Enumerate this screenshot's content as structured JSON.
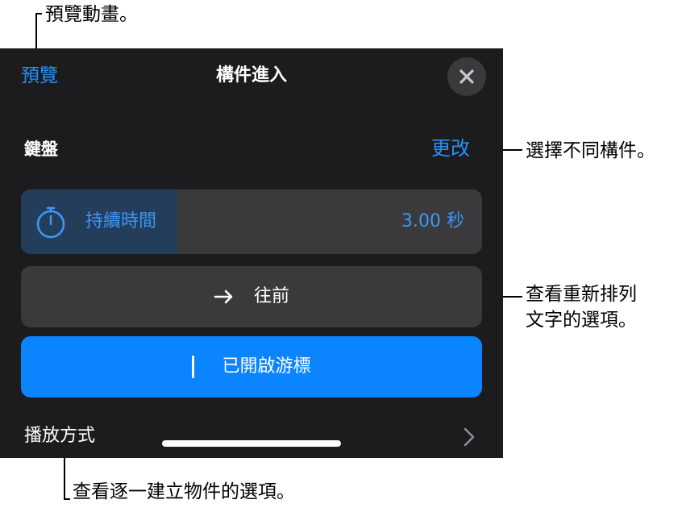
{
  "callouts": {
    "preview": "預覽動畫。",
    "change": "選擇不同構件。",
    "direction_line1": "查看重新排列",
    "direction_line2": "文字的選項。",
    "delivery": "查看逐一建立物件的選項。"
  },
  "panel": {
    "preview_label": "預覽",
    "title": "構件進入",
    "build_name": "鍵盤",
    "change_label": "更改",
    "duration": {
      "label": "持續時間",
      "value": "3.00 秒",
      "fill_fraction": 0.34
    },
    "direction_label": "往前",
    "cursor_label": "已開啟游標",
    "delivery_label": "播放方式"
  },
  "colors": {
    "panel_bg": "#1c1c1e",
    "control_bg": "#3a3a3c",
    "accent": "#0a84ff",
    "link": "#2c8ef8",
    "duration_fill": "#233d5a"
  },
  "icons": {
    "close": "close-icon",
    "stopwatch": "stopwatch-icon",
    "arrow": "arrow-right-icon",
    "chevron": "chevron-right-icon"
  }
}
